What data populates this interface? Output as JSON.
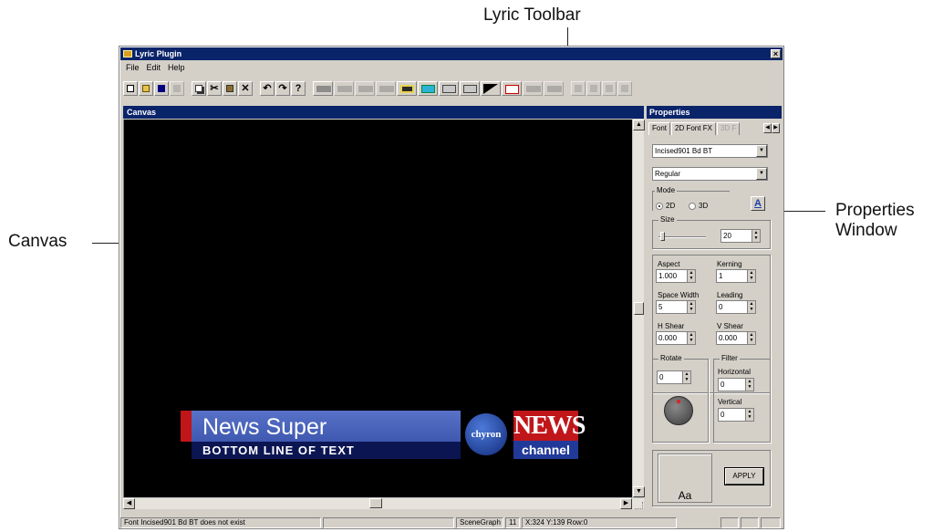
{
  "annotations": {
    "toolbar": "Lyric Toolbar",
    "canvas": "Canvas",
    "properties_line1": "Properties",
    "properties_line2": "Window"
  },
  "window": {
    "title": "Lyric Plugin",
    "close_glyph": "×"
  },
  "menu": [
    "File",
    "Edit",
    "Help"
  ],
  "toolbar_icons": [
    "new-file-icon",
    "open-folder-icon",
    "save-icon",
    "print-icon",
    "copy-icon",
    "cut-icon",
    "paste-icon",
    "delete-icon",
    "undo-icon",
    "redo-icon",
    "help-icon",
    "template-icon",
    "layer-icon",
    "layer-icon",
    "layer-icon",
    "scene-icon",
    "background-icon",
    "monitor-icon",
    "txt-icon",
    "triangle-icon",
    "checkmark-icon",
    "layer-icon",
    "layer-icon",
    "align-icon",
    "align-icon",
    "align-icon",
    "align-icon"
  ],
  "canvas_panel": {
    "title": "Canvas",
    "lower_third": {
      "title": "News Super",
      "subtitle": "BOTTOM LINE OF TEXT",
      "logo_text": "chyron",
      "news_text": "NEWS",
      "channel_text": "channel"
    }
  },
  "properties": {
    "title": "Properties",
    "tabs": [
      "Font",
      "2D Font FX",
      "3D F"
    ],
    "font_name": "Incised901 Bd BT",
    "font_style": "Regular",
    "mode": {
      "label": "Mode",
      "options": [
        "2D",
        "3D"
      ],
      "selected": "2D",
      "aa_label": "A"
    },
    "size": {
      "label": "Size",
      "value": "20"
    },
    "aspect": {
      "label": "Aspect",
      "value": "1.000"
    },
    "kerning": {
      "label": "Kerning",
      "value": "1"
    },
    "space_width": {
      "label": "Space Width",
      "value": "5"
    },
    "leading": {
      "label": "Leading",
      "value": "0"
    },
    "h_shear": {
      "label": "H Shear",
      "value": "0.000"
    },
    "v_shear": {
      "label": "V Shear",
      "value": "0.000"
    },
    "rotate": {
      "label": "Rotate",
      "value": "0"
    },
    "filter": {
      "label": "Filter",
      "horizontal_label": "Horizontal",
      "horizontal_value": "0",
      "vertical_label": "Vertical",
      "vertical_value": "0"
    },
    "preview_text": "Aa",
    "apply_label": "APPLY"
  },
  "status": {
    "message": "Font Incised901 Bd BT does not exist",
    "mode": "SceneGraph",
    "line": "11",
    "coords": "X:324  Y:139  Row:0"
  },
  "colors": {
    "titlebar": "#0a246a",
    "canvas_bg": "#000000",
    "news_red": "#c0161a",
    "lower_third_blue": "#4a64bc"
  }
}
